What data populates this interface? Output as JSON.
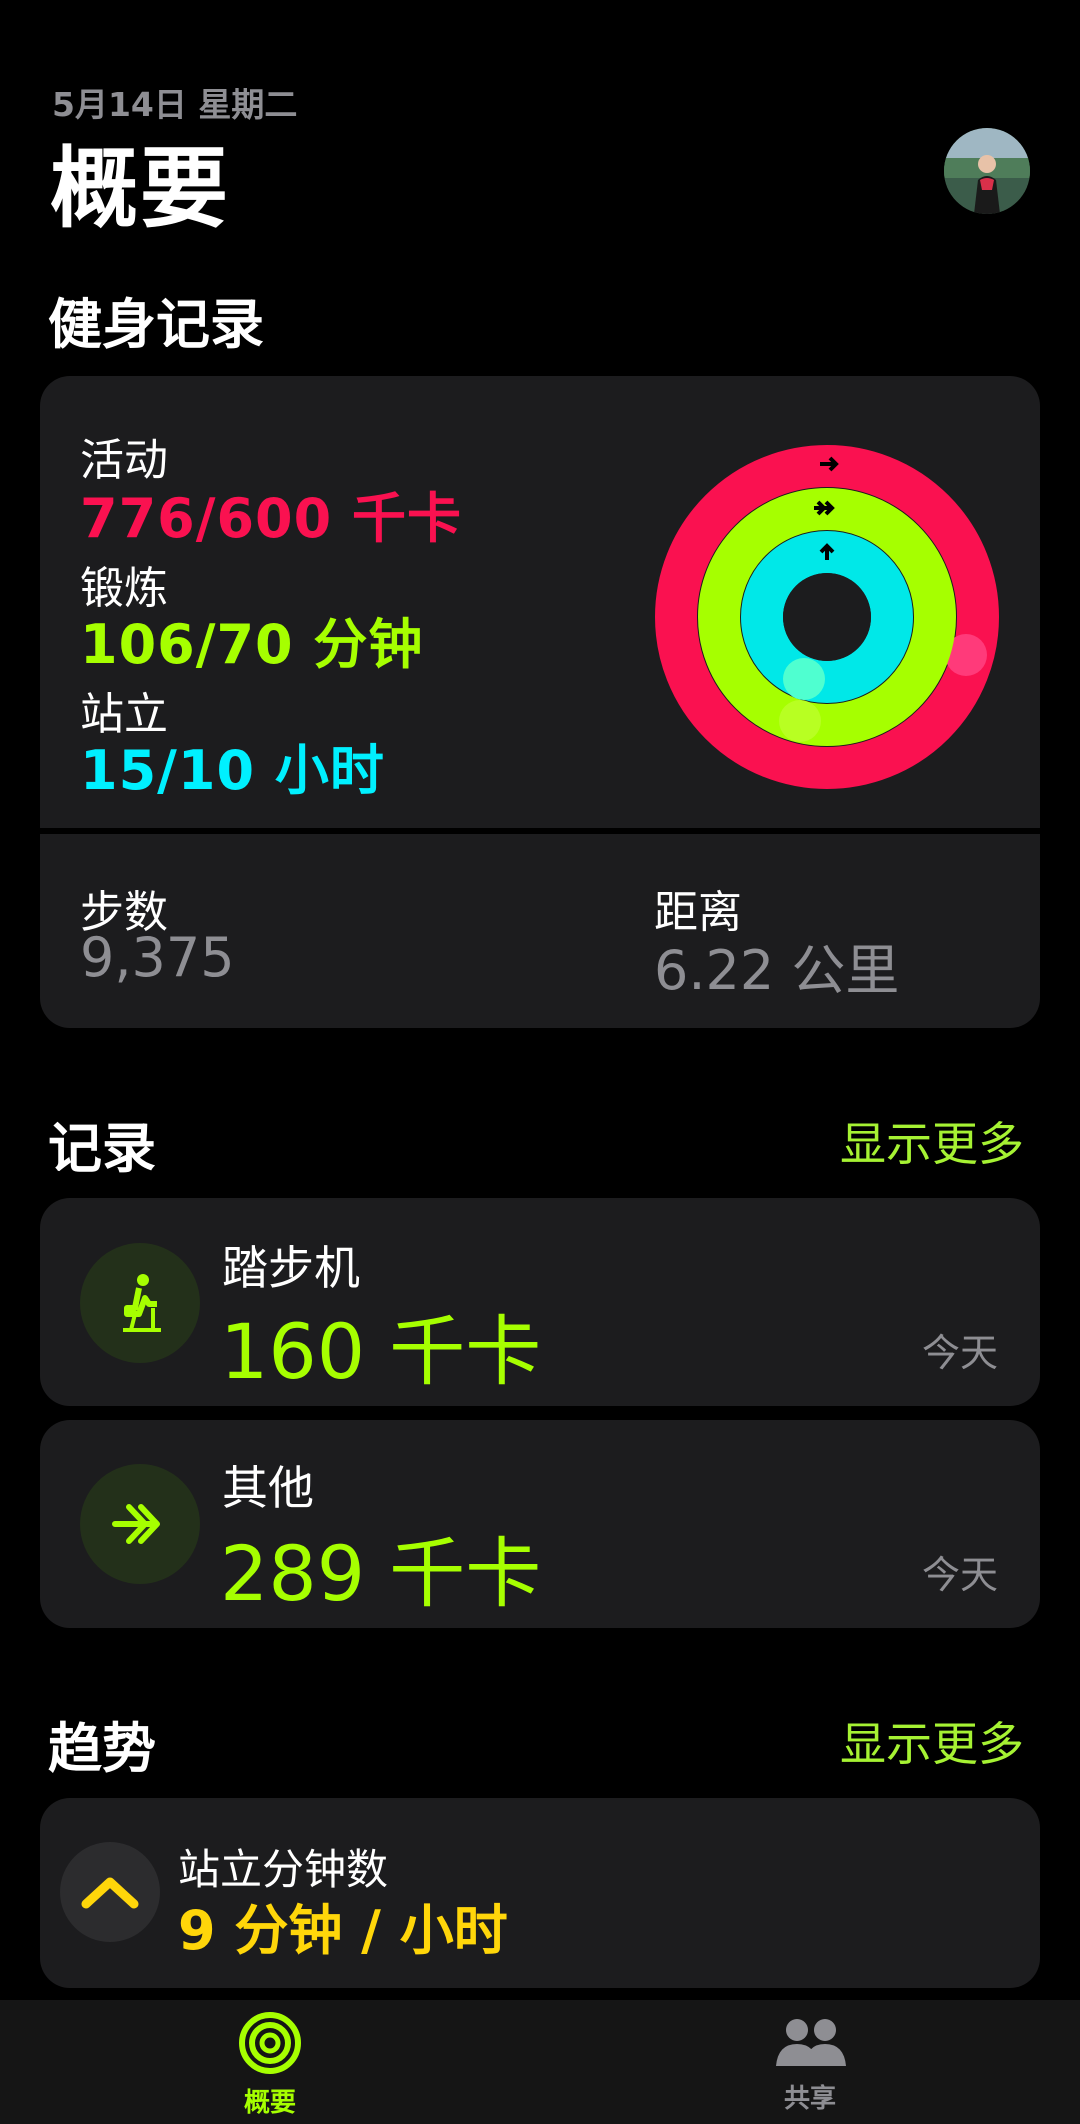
{
  "header": {
    "date": "5月14日 星期二",
    "title": "概要"
  },
  "fitness": {
    "heading": "健身记录",
    "move": {
      "label": "活动",
      "value": "776/600 千卡",
      "progress": 1.29,
      "color": "#fa1150"
    },
    "exercise": {
      "label": "锻炼",
      "value": "106/70 分钟",
      "progress": 1.51,
      "color": "#a6ff00"
    },
    "stand": {
      "label": "站立",
      "value": "15/10 小时",
      "progress": 1.5,
      "color": "#00f0ff"
    },
    "steps": {
      "label": "步数",
      "value": "9,375"
    },
    "distance": {
      "label": "距离",
      "value": "6.22 公里"
    }
  },
  "records": {
    "heading": "记录",
    "more": "显示更多",
    "items": [
      {
        "name": "踏步机",
        "value": "160 千卡",
        "when": "今天",
        "icon": "stair-stepper-icon"
      },
      {
        "name": "其他",
        "value": "289 千卡",
        "when": "今天",
        "icon": "double-arrow-icon"
      }
    ]
  },
  "trends": {
    "heading": "趋势",
    "more": "显示更多",
    "item": {
      "name": "站立分钟数",
      "value": "9 分钟 / 小时",
      "icon": "chevron-up-icon",
      "color": "#ffd60a"
    }
  },
  "tabbar": {
    "tabs": [
      {
        "label": "概要",
        "active": true,
        "icon": "activity-rings-icon"
      },
      {
        "label": "共享",
        "active": false,
        "icon": "people-icon"
      }
    ]
  }
}
